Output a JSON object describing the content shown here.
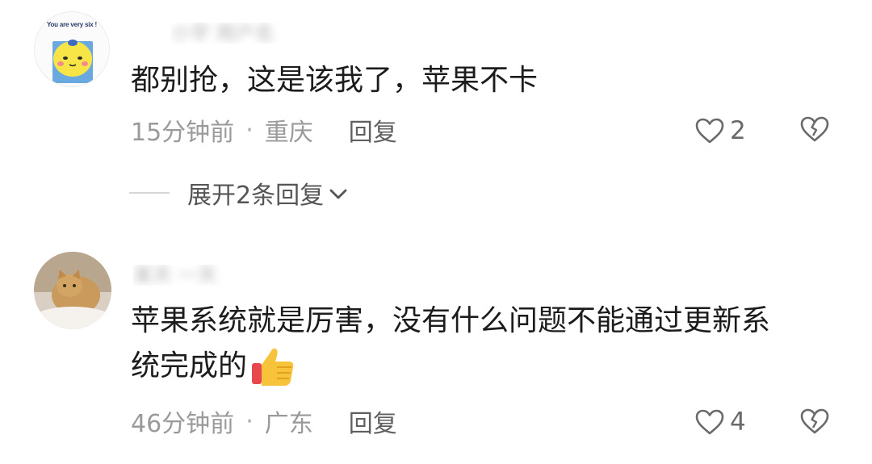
{
  "comments": [
    {
      "avatar_text": "You are very six !",
      "username": "小宇 用户名",
      "text": "都别抢，这是该我了，苹果不卡",
      "time": "15分钟前",
      "location": "重庆",
      "reply_label": "回复",
      "likes": "2",
      "expand_label": "展开2条回复"
    },
    {
      "username": "某天 一天",
      "text_line1": "苹果系统就是厉害，没有什么问题不能通过更新系",
      "text_line2": "统完成的",
      "time": "46分钟前",
      "location": "广东",
      "reply_label": "回复",
      "likes": "4"
    }
  ],
  "separator": "·",
  "icons": {
    "like": "heart-outline-icon",
    "dislike": "broken-heart-icon",
    "expand": "chevron-down-icon",
    "emoji": "thumbs-up-emoji"
  },
  "colors": {
    "text": "#1c1c1c",
    "meta": "#9a9a9a",
    "reply": "#5f5f5f",
    "icon": "#6a6a6a"
  }
}
